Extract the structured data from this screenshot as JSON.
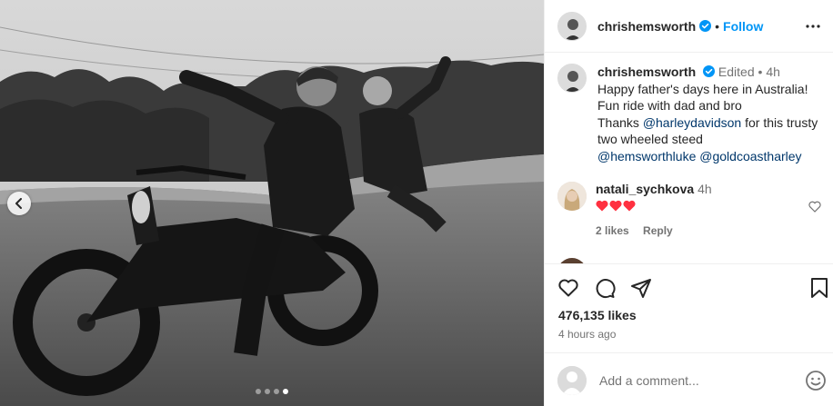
{
  "post": {
    "username": "chrishemsworth",
    "follow_label": "Follow",
    "separator": "•",
    "media": {
      "slide_count": 4,
      "active_slide": 4,
      "prev_icon": "chevron-left-icon"
    }
  },
  "caption": {
    "username": "chrishemsworth",
    "edited": "Edited",
    "dot": "•",
    "age": "4h",
    "line1": "Happy father's days here in Australia!",
    "line2": "Fun ride with dad and bro",
    "line3_prefix": "Thanks ",
    "line3_mention": "@harleydavidson",
    "line3_suffix": " for this trusty",
    "line4": "two wheeled steed",
    "mention1": "@hemsworthluke",
    "mention2": "@goldcoastharley"
  },
  "comment": {
    "username": "natali_sychkova",
    "age": "4h",
    "hearts_count": 3,
    "likes": "2 likes",
    "reply": "Reply"
  },
  "footer": {
    "likes": "476,135 likes",
    "time": "4 hours ago",
    "add_comment_placeholder": "Add a comment..."
  },
  "colors": {
    "accent": "#0095f6",
    "verified": "#0095f6",
    "heart": "#ff3040",
    "text": "#262626",
    "secondary": "#737373",
    "mention": "#00376b"
  }
}
